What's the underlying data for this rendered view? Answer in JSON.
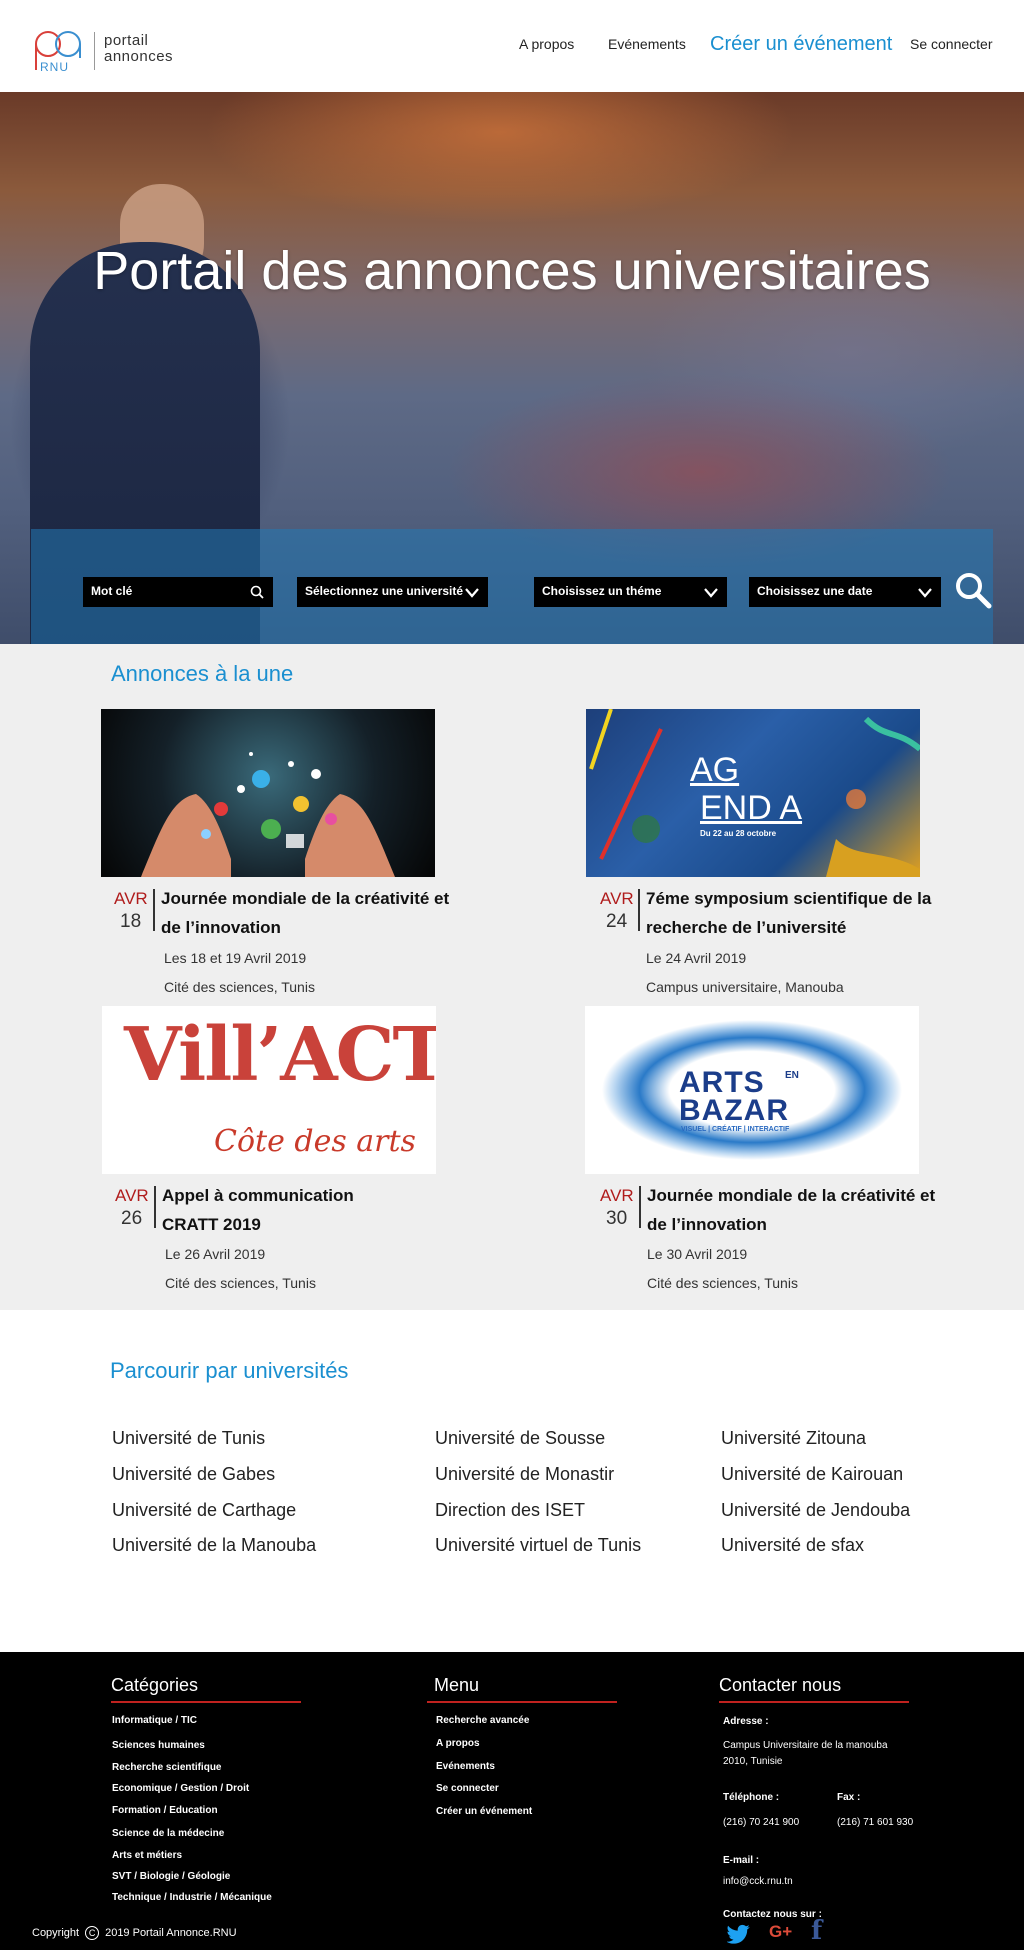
{
  "header": {
    "logo_line1": "portail",
    "logo_line2": "annonces",
    "logo_sub": "RNU",
    "nav": [
      "A propos",
      "Evénements",
      "Créer un événement",
      "Se connecter"
    ]
  },
  "hero": {
    "title": "Portail des annonces universitaires",
    "search": {
      "keyword": "Mot clé",
      "university": "Sélectionnez une université",
      "theme": "Choisissez un théme",
      "date": "Choisissez une date"
    }
  },
  "featured": {
    "title": "Annonces à la une",
    "cards": [
      {
        "month": "AVR",
        "day": "18",
        "title": "Journée mondiale de la créativité et de l’innovation",
        "dates": "Les 18 et 19 Avril 2019",
        "place": "Cité des sciences, Tunis"
      },
      {
        "month": "AVR",
        "day": "24",
        "title": "7éme symposium scientifique de la recherche de l’université",
        "dates": "Le 24 Avril 2019",
        "place": "Campus universitaire, Manouba"
      },
      {
        "month": "AVR",
        "day": "26",
        "title": "Appel à communication CRATT 2019",
        "dates": "Le 26 Avril 2019",
        "place": "Cité des sciences, Tunis"
      },
      {
        "month": "AVR",
        "day": "30",
        "title": "Journée mondiale de la créativité et de l’innovation",
        "dates": "Le 30 Avril 2019",
        "place": "Cité des sciences, Tunis"
      }
    ],
    "agenda_img": {
      "line1": "AG",
      "line2": "END A",
      "sub": "Du 22 au 28 octobre"
    },
    "villact_img": {
      "line1": "Vill’ACT",
      "line2": "Côte des arts"
    },
    "bazar_img": {
      "line1": "ARTS",
      "line2": "BAZAR",
      "small": "EN",
      "sub": "VISUEL | CRÉATIF | INTERACTIF"
    }
  },
  "universities": {
    "title": "Parcourir par universités",
    "col1": [
      "Université de Tunis",
      "Université de Gabes",
      "Université de Carthage",
      "Université de la Manouba"
    ],
    "col2": [
      "Université de Sousse",
      "Université de Monastir",
      "Direction des ISET",
      "Université virtuel de Tunis"
    ],
    "col3": [
      "Université Zitouna",
      "Université de Kairouan",
      "Université de Jendouba",
      "Université de sfax"
    ]
  },
  "footer": {
    "categories_title": "Catégories",
    "categories": [
      "Informatique / TIC",
      "Sciences humaines",
      "Recherche scientifique",
      "Economique / Gestion / Droit",
      "Formation / Education",
      "Science de la médecine",
      "Arts et métiers",
      "SVT / Biologie / Géologie",
      "Technique / Industrie / Mécanique"
    ],
    "menu_title": "Menu",
    "menu": [
      "Recherche avancée",
      "A propos",
      "Evénements",
      "Se  connecter",
      "Créer un événement"
    ],
    "contact_title": "Contacter nous",
    "address_label": "Adresse :",
    "address_line1": "Campus Universitaire de la manouba",
    "address_line2": "2010, Tunisie",
    "phone_label": "Téléphone :",
    "phone": "(216) 70 241 900",
    "fax_label": "Fax :",
    "fax": "(216) 71 601 930",
    "email_label": "E-mail :",
    "email": "info@cck.rnu.tn",
    "social_label": "Contactez nous sur :",
    "copyright_prefix": "Copyright",
    "copyright_text": "2019 Portail Annonce.RNU"
  },
  "colors": {
    "accent": "#1a8fd0",
    "date_red": "#b01c1c",
    "footer_line": "#c0221f"
  }
}
